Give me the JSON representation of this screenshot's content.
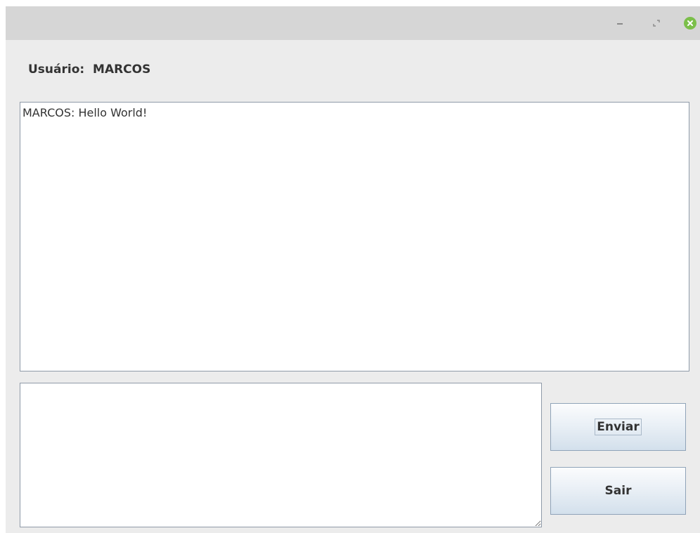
{
  "window": {
    "controls": {
      "minimize_icon": "minimize-icon",
      "maximize_icon": "maximize-icon",
      "close_icon": "close-icon",
      "close_color": "#7bbf4a"
    }
  },
  "user": {
    "label": "Usuário:  MARCOS"
  },
  "chat": {
    "messages": [
      "MARCOS: Hello World!"
    ]
  },
  "message_input": {
    "value": ""
  },
  "buttons": {
    "send_label": "Enviar",
    "exit_label": "Sair"
  }
}
